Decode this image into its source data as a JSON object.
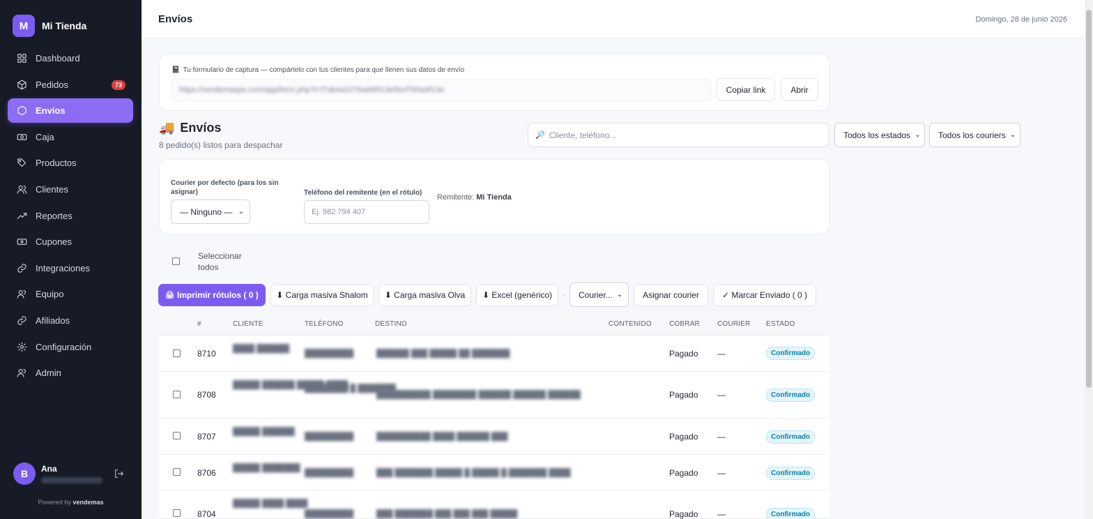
{
  "brand": {
    "initial": "M",
    "name": "Mi Tienda"
  },
  "nav": [
    {
      "label": "Dashboard",
      "icon": "dashboard-icon"
    },
    {
      "label": "Pedidos",
      "icon": "box-icon",
      "badge": "73"
    },
    {
      "label": "Envíos",
      "icon": "hexagon-icon",
      "active": true
    },
    {
      "label": "Caja",
      "icon": "cash-icon"
    },
    {
      "label": "Productos",
      "icon": "tag-icon"
    },
    {
      "label": "Clientes",
      "icon": "users-icon"
    },
    {
      "label": "Reportes",
      "icon": "trend-icon"
    },
    {
      "label": "Cupones",
      "icon": "coupon-icon"
    },
    {
      "label": "Integraciones",
      "icon": "link-icon"
    },
    {
      "label": "Equipo",
      "icon": "team-icon"
    },
    {
      "label": "Afiliados",
      "icon": "link-icon"
    },
    {
      "label": "Configuración",
      "icon": "gear-icon"
    },
    {
      "label": "Admin",
      "icon": "admin-icon"
    }
  ],
  "user": {
    "initial": "B",
    "name": "Ana"
  },
  "powered": {
    "prefix": "Powered by",
    "brand": "vendemas"
  },
  "header": {
    "title": "Envíos",
    "date": "Domingo, 28 de junio 2026"
  },
  "capture_form": {
    "label": "Tu formulario de captura — compártelo con tus clientes para que llenen sus datos de envío",
    "url": "https://vendemaspe.com/app/form.php?t=f7ab4a2279add5f13e5bcf7b5a9f13e",
    "copy_label": "Copiar link",
    "open_label": "Abrir"
  },
  "shipments": {
    "title": "Envíos",
    "subtitle": "8 pedido(s) listos para despachar",
    "search_placeholder": "Cliente, teléfono...",
    "status_filter": "Todos los estados",
    "courier_filter": "Todos los couriers"
  },
  "defaults": {
    "courier_label": "Courier por defecto (para los sin asignar)",
    "courier_value": "— Ninguno —",
    "phone_label": "Teléfono del remitente (en el rótulo)",
    "phone_placeholder": "Ej. 982 794 407",
    "sender_label": "Remitente:",
    "sender_value": "Mi Tienda"
  },
  "select_all": "Seleccionar todos",
  "actions": {
    "print": "Imprimir rótulos ( 0 )",
    "shalom": "⬇ Carga masiva Shalom",
    "olva": "⬇ Carga masiva Olva",
    "excel": "⬇ Excel (genérico)",
    "separator": "·",
    "courier_select": "Courier...",
    "assign": "Asignar courier",
    "mark_sent": "✓ Marcar Enviado ( 0 )"
  },
  "table": {
    "headers": [
      "#",
      "Cliente",
      "Teléfono",
      "Destino",
      "Contenido",
      "Cobrar",
      "Courier",
      "Estado"
    ],
    "rows": [
      {
        "id": "8710",
        "cobrar": "Pagado",
        "courier": "—",
        "estado": "Confirmado"
      },
      {
        "id": "8708",
        "cobrar": "Pagado",
        "courier": "—",
        "estado": "Confirmado"
      },
      {
        "id": "8707",
        "cobrar": "Pagado",
        "courier": "—",
        "estado": "Confirmado"
      },
      {
        "id": "8706",
        "cobrar": "Pagado",
        "courier": "—",
        "estado": "Confirmado"
      },
      {
        "id": "8704",
        "cobrar": "Pagado",
        "courier": "—",
        "estado": "Confirmado"
      }
    ]
  },
  "colors": {
    "accent": "#7c5cf0",
    "sidebar": "#161b26",
    "badge": "#e03e3e",
    "status": "#0e7fa8"
  }
}
